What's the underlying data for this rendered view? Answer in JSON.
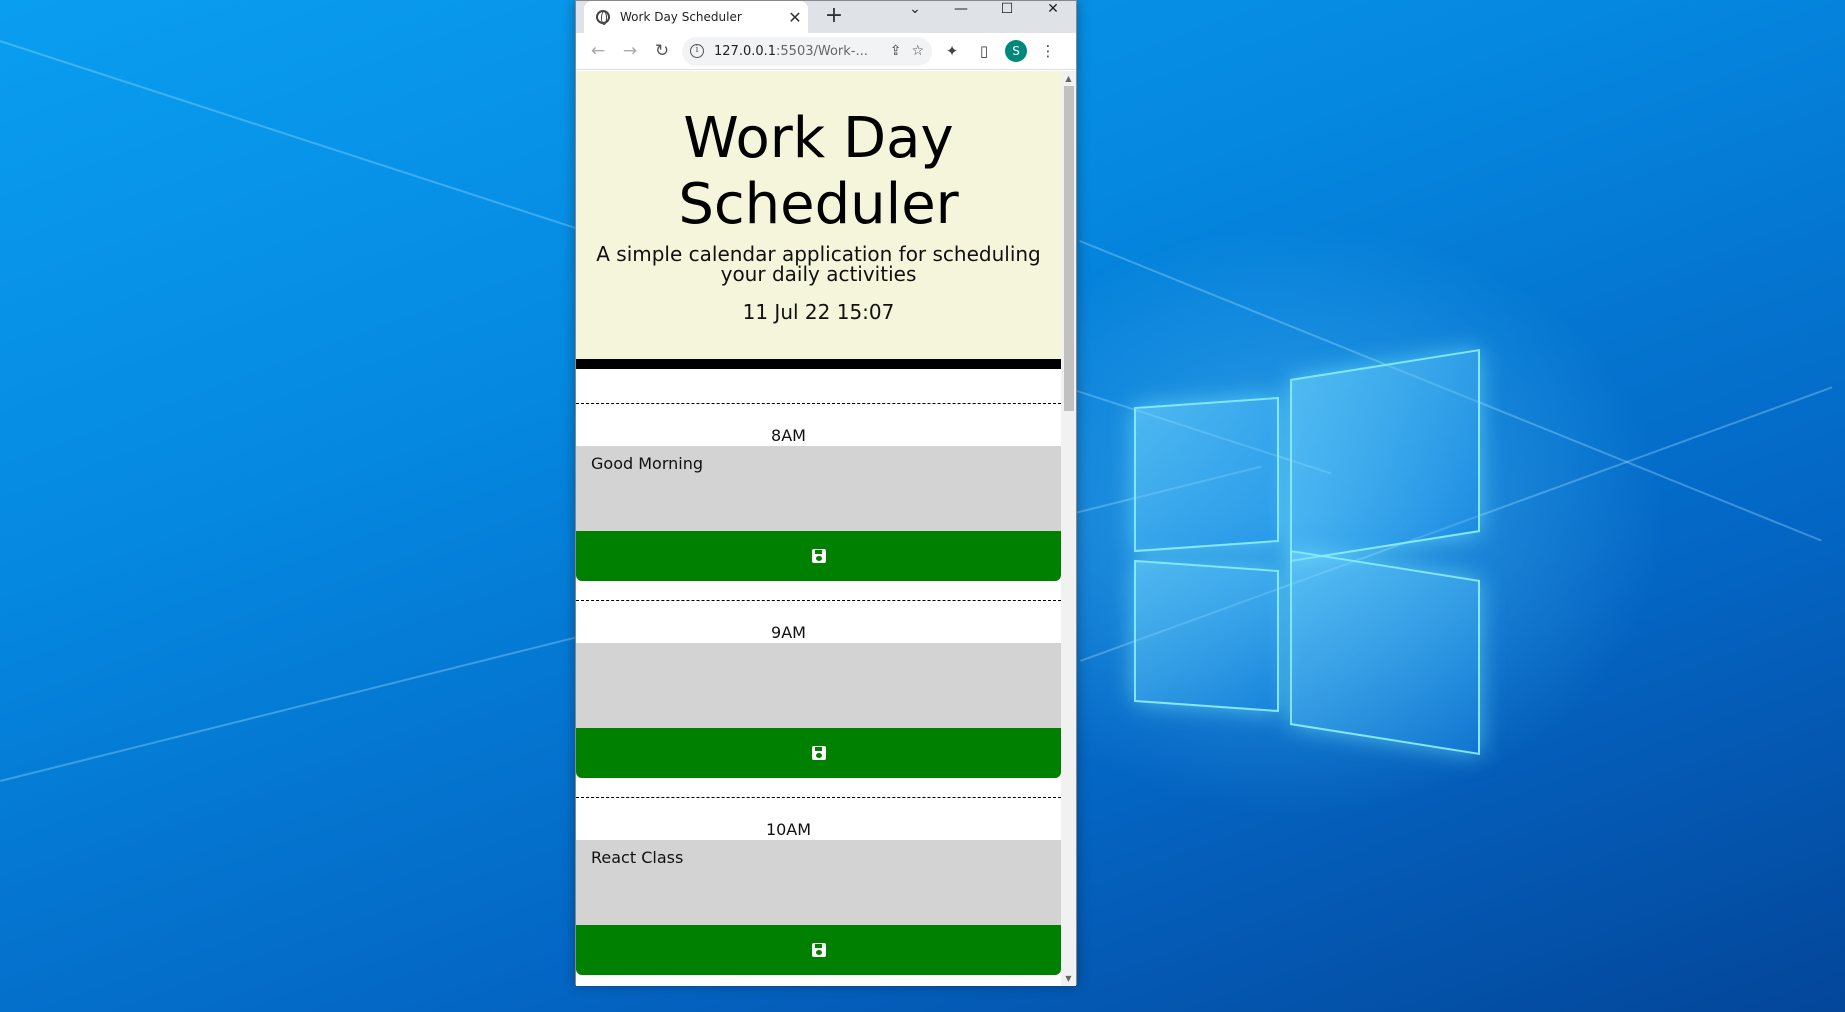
{
  "browser": {
    "tab_title": "Work Day Scheduler",
    "tab_close": "✕",
    "new_tab": "+",
    "url_host": "127.0.0.1",
    "url_rest": ":5503/Work-...",
    "profile_initial": "S"
  },
  "header": {
    "title": "Work Day Scheduler",
    "lead": "A simple calendar application for scheduling your daily activities",
    "current_day": "11 Jul 22 15:07"
  },
  "time_blocks": [
    {
      "hour": "8AM",
      "text": "Good Morning"
    },
    {
      "hour": "9AM",
      "text": ""
    },
    {
      "hour": "10AM",
      "text": "React Class"
    }
  ],
  "colors": {
    "jumbotron_bg": "#f5f5dc",
    "save_button": "#008000",
    "textarea_bg": "#d3d3d3"
  }
}
